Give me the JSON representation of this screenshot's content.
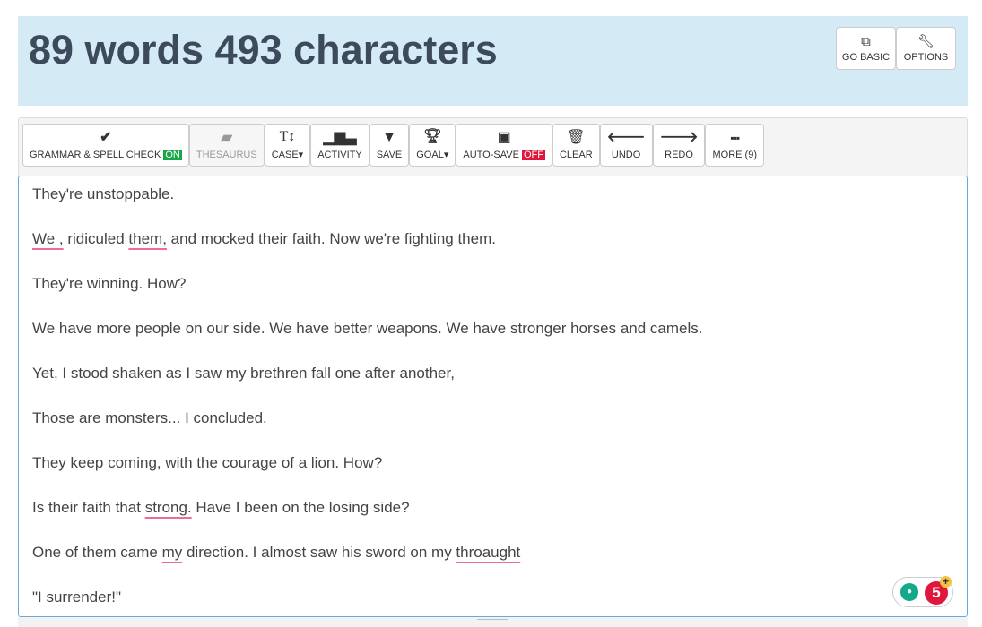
{
  "header": {
    "title": "89 words 493 characters",
    "go_basic": "GO BASIC",
    "options": "OPTIONS"
  },
  "toolbar": {
    "grammar": "GRAMMAR & SPELL CHECK",
    "grammar_state": "ON",
    "thesaurus": "THESAURUS",
    "case": "CASE",
    "activity": "ACTIVITY",
    "save": "SAVE",
    "goal": "GOAL",
    "autosave": "AUTO-SAVE",
    "autosave_state": "OFF",
    "clear": "CLEAR",
    "undo": "UNDO",
    "redo": "REDO",
    "more": "MORE (9)"
  },
  "editor": {
    "lines": [
      [
        {
          "t": "They're unstoppable."
        }
      ],
      [
        {
          "t": "We ,",
          "e": 1
        },
        {
          "t": " ridiculed "
        },
        {
          "t": "them,",
          "e": 1
        },
        {
          "t": " and mocked their faith. Now we're fighting them."
        }
      ],
      [
        {
          "t": "They're winning. How?"
        }
      ],
      [
        {
          "t": "We have more people on our side. We have better weapons. We have stronger horses and camels."
        }
      ],
      [
        {
          "t": "Yet, I stood shaken as I saw my brethren fall one after another,"
        }
      ],
      [
        {
          "t": "Those are monsters... I concluded."
        }
      ],
      [
        {
          "t": "They keep coming, with the courage of a lion. How?"
        }
      ],
      [
        {
          "t": "Is their faith that "
        },
        {
          "t": "strong.",
          "e": 1
        },
        {
          "t": " Have I been on the losing side?"
        }
      ],
      [
        {
          "t": "One of them came "
        },
        {
          "t": "my",
          "e": 1
        },
        {
          "t": " direction. I almost saw his sword on my "
        },
        {
          "t": "throaught",
          "e": 1
        }
      ],
      [
        {
          "t": "\"I surrender!\""
        }
      ]
    ]
  },
  "badge": {
    "count": "5",
    "plus": "+"
  }
}
